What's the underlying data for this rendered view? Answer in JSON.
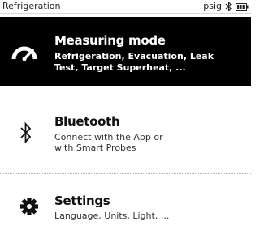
{
  "status_bar": {
    "title": "Refrigeration",
    "unit": "psig",
    "icons": [
      "bluetooth-icon",
      "battery-icon"
    ]
  },
  "menu": {
    "items": [
      {
        "title": "Measuring mode",
        "description_line1": "Refrigeration, Evacuation, Leak",
        "description_line2": "Test, Target Superheat, ...",
        "icon": "gauge-icon",
        "selected": true
      },
      {
        "title": "Bluetooth",
        "description_line1": "Connect with the App or",
        "description_line2": "with Smart Probes",
        "icon": "bluetooth-icon",
        "selected": false
      },
      {
        "title": "Settings",
        "description_line1": "Language, Units, Light, ...",
        "icon": "gear-icon",
        "selected": false
      }
    ]
  },
  "colors": {
    "selected_background": "#000000",
    "selected_text": "#ffffff",
    "text": "#111111",
    "background": "#ffffff"
  }
}
